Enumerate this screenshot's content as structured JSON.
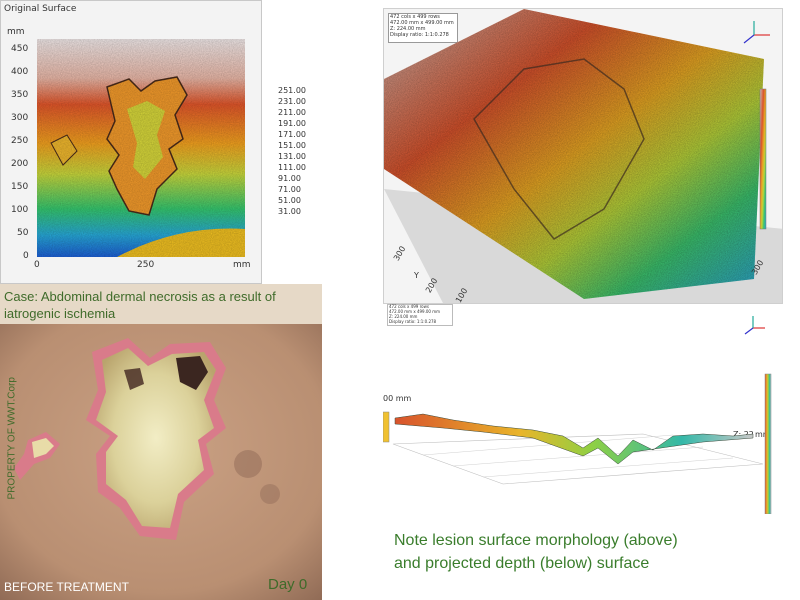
{
  "top_left": {
    "title": "Original Surface",
    "y_unit": "mm",
    "x_unit": "mm",
    "y_ticks": [
      "450",
      "400",
      "350",
      "300",
      "250",
      "200",
      "150",
      "100",
      "50",
      "0"
    ],
    "x_ticks": [
      "0",
      "250"
    ],
    "colorbar_unit": "mm",
    "colorbar_ticks": [
      "251.00",
      "231.00",
      "211.00",
      "191.00",
      "171.00",
      "151.00",
      "131.00",
      "111.00",
      "91.00",
      "71.00",
      "51.00",
      "31.00"
    ]
  },
  "photo": {
    "case_text_line1": "Case: Abdominal dermal necrosis as a result of",
    "case_text_line2": "iatrogenic ischemia",
    "watermark": "PROPERTY OF WWT.Corp",
    "before_label": "BEFORE TREATMENT",
    "day_label": "Day 0"
  },
  "top_right": {
    "info_line1": "472 cols x 499 rows",
    "info_line2": "472.00 mm x 499.00 mm",
    "info_line3": "Z: 224.00 mm",
    "info_line4": "Display ratio: 1:1:0.278",
    "axis_ticks": [
      "300",
      "200",
      "100",
      "300"
    ],
    "axis_label": "Y"
  },
  "bottom_right": {
    "info_line1": "472 cols x 499 rows",
    "info_line2": "472.00 mm x 499.00 mm",
    "info_line3": "Z: 224.00 mm",
    "info_line4": "Display ratio: 1:1:0.278",
    "left_label": "00 mm",
    "right_label": "Z: 22",
    "right_unit": "mm"
  },
  "note": {
    "line1": "Note lesion surface morphology (above)",
    "line2": "and projected depth (below) surface"
  },
  "colors": {
    "caption_green": "#3a7d2c",
    "skin": "#cfa888",
    "wound_rim": "#d97b8a"
  }
}
